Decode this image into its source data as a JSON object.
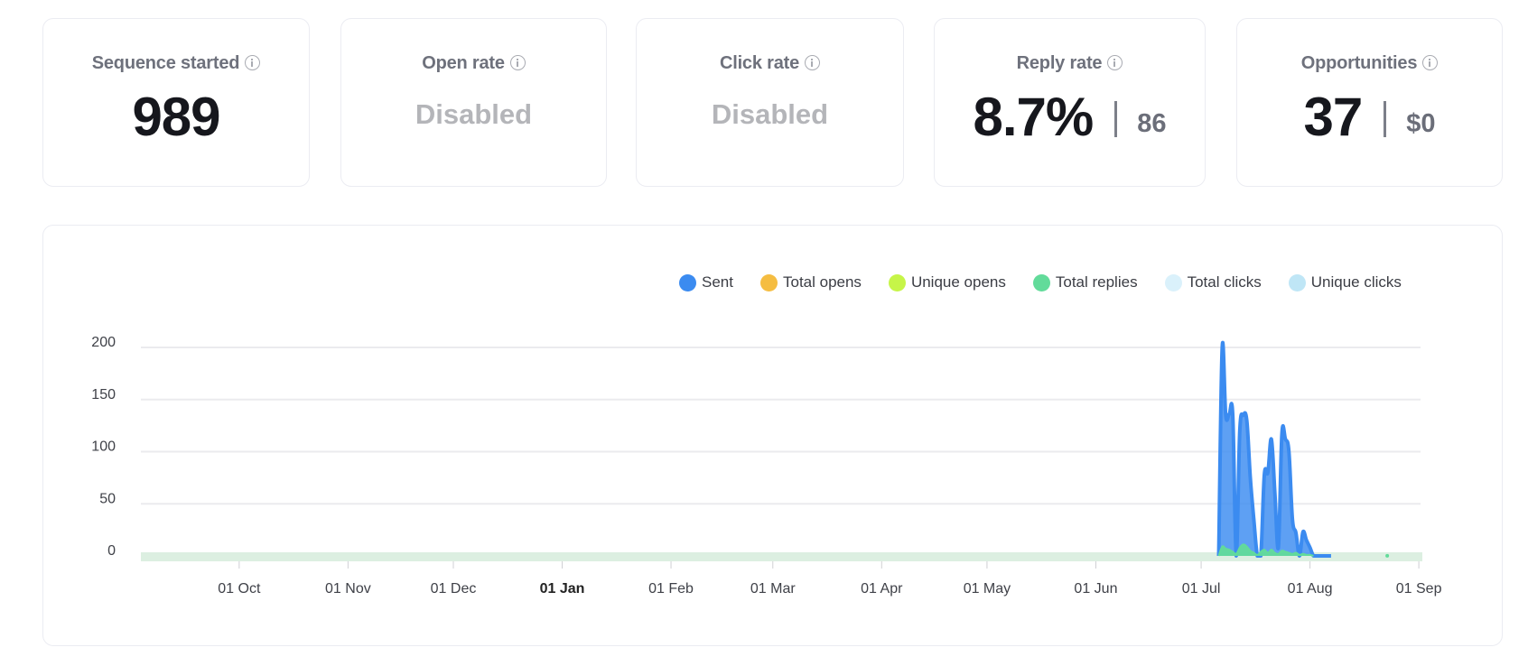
{
  "cards": [
    {
      "title": "Sequence started",
      "value": "989",
      "type": "number"
    },
    {
      "title": "Open rate",
      "value": "Disabled",
      "type": "disabled"
    },
    {
      "title": "Click rate",
      "value": "Disabled",
      "type": "disabled"
    },
    {
      "title": "Reply rate",
      "value": "8.7%",
      "secondary": "86",
      "type": "split"
    },
    {
      "title": "Opportunities",
      "value": "37",
      "secondary": "$0",
      "type": "split"
    }
  ],
  "icons": {
    "info": "info-circle-icon"
  },
  "chart_data": {
    "type": "area",
    "title": "",
    "xlabel": "",
    "ylabel": "",
    "ylim": [
      0,
      200
    ],
    "yticks": [
      0,
      50,
      100,
      150,
      200
    ],
    "grid": true,
    "legend_position": "top-right",
    "x_range": [
      "2023-09-03",
      "2024-09-02"
    ],
    "xticks": [
      {
        "label": "01 Oct",
        "date": "2023-10-01",
        "bold": false
      },
      {
        "label": "01 Nov",
        "date": "2023-11-01",
        "bold": false
      },
      {
        "label": "01 Dec",
        "date": "2023-12-01",
        "bold": false
      },
      {
        "label": "01 Jan",
        "date": "2024-01-01",
        "bold": true
      },
      {
        "label": "01 Feb",
        "date": "2024-02-01",
        "bold": false
      },
      {
        "label": "01 Mar",
        "date": "2024-03-01",
        "bold": false
      },
      {
        "label": "01 Apr",
        "date": "2024-04-01",
        "bold": false
      },
      {
        "label": "01 May",
        "date": "2024-05-01",
        "bold": false
      },
      {
        "label": "01 Jun",
        "date": "2024-06-01",
        "bold": false
      },
      {
        "label": "01 Jul",
        "date": "2024-07-01",
        "bold": false
      },
      {
        "label": "01 Aug",
        "date": "2024-08-01",
        "bold": false
      },
      {
        "label": "01 Sep",
        "date": "2024-09-01",
        "bold": false
      }
    ],
    "legend": [
      {
        "name": "Sent",
        "color": "#3b8bf0"
      },
      {
        "name": "Total opens",
        "color": "#f5bd41"
      },
      {
        "name": "Unique opens",
        "color": "#c6f548"
      },
      {
        "name": "Total replies",
        "color": "#62db9a"
      },
      {
        "name": "Total clicks",
        "color": "#daf1fb"
      },
      {
        "name": "Unique clicks",
        "color": "#bfe6f6"
      }
    ],
    "series": [
      {
        "name": "Sent",
        "color": "#3b8bf0",
        "x": [
          "2024-07-06",
          "2024-07-07",
          "2024-07-08",
          "2024-07-09",
          "2024-07-10",
          "2024-07-11",
          "2024-07-12",
          "2024-07-13",
          "2024-07-14",
          "2024-07-15",
          "2024-07-16",
          "2024-07-17",
          "2024-07-18",
          "2024-07-19",
          "2024-07-20",
          "2024-07-21",
          "2024-07-22",
          "2024-07-23",
          "2024-07-24",
          "2024-07-25",
          "2024-07-26",
          "2024-07-27",
          "2024-07-28",
          "2024-07-29",
          "2024-07-30",
          "2024-07-31",
          "2024-08-01",
          "2024-08-02",
          "2024-08-03",
          "2024-08-04",
          "2024-08-05",
          "2024-08-06",
          "2024-08-07"
        ],
        "values": [
          0,
          200,
          135,
          136,
          135,
          0,
          120,
          135,
          130,
          75,
          35,
          0,
          0,
          78,
          80,
          112,
          60,
          8,
          117,
          112,
          100,
          35,
          22,
          0,
          23,
          15,
          8,
          0,
          0,
          0,
          0,
          0,
          0
        ]
      },
      {
        "name": "Total replies",
        "color": "#62db9a",
        "x": [
          "2024-07-06",
          "2024-07-07",
          "2024-07-08",
          "2024-07-09",
          "2024-07-10",
          "2024-07-11",
          "2024-07-12",
          "2024-07-13",
          "2024-07-14",
          "2024-07-15",
          "2024-07-16",
          "2024-07-17",
          "2024-07-18",
          "2024-07-19",
          "2024-07-20",
          "2024-07-21",
          "2024-07-22",
          "2024-07-23",
          "2024-07-24",
          "2024-07-25",
          "2024-07-26",
          "2024-07-27",
          "2024-07-28",
          "2024-07-29",
          "2024-07-30",
          "2024-07-31",
          "2024-08-01",
          "2024-08-02",
          "2024-08-23"
        ],
        "values": [
          0,
          9,
          7,
          6,
          4,
          2,
          8,
          11,
          9,
          5,
          3,
          1,
          4,
          6,
          3,
          6,
          3,
          2,
          5,
          4,
          3,
          2,
          3,
          1,
          2,
          1,
          1,
          0,
          1
        ]
      },
      {
        "name": "Total opens",
        "color": "#f5bd41",
        "x": [],
        "values": []
      },
      {
        "name": "Unique opens",
        "color": "#c6f548",
        "x": [],
        "values": []
      },
      {
        "name": "Total clicks",
        "color": "#daf1fb",
        "x": [],
        "values": []
      },
      {
        "name": "Unique clicks",
        "color": "#bfe6f6",
        "x": [],
        "values": []
      }
    ]
  }
}
